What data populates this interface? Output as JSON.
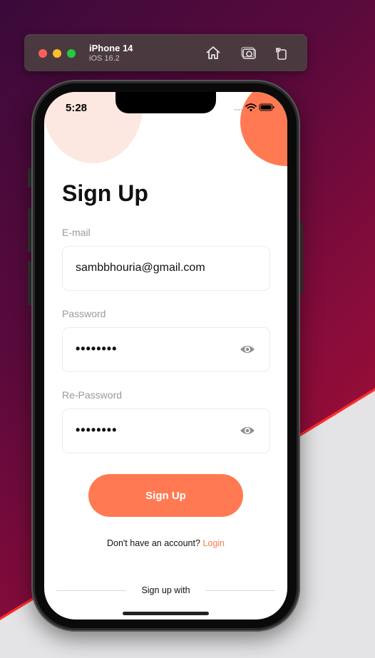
{
  "simulator": {
    "device_name": "iPhone 14",
    "os_version": "iOS 16.2",
    "toolbar_icons": [
      "home-icon",
      "screenshot-icon",
      "rotate-icon"
    ]
  },
  "status_bar": {
    "time": "5:28",
    "icons": [
      "cellular-icon",
      "wifi-icon",
      "battery-icon"
    ]
  },
  "signup": {
    "title": "Sign Up",
    "email_label": "E-mail",
    "email_value": "sambbhouria@gmail.com",
    "password_label": "Password",
    "password_value": "••••••••",
    "repassword_label": "Re-Password",
    "repassword_value": "••••••••",
    "button_label": "Sign Up",
    "account_prompt": "Don't have an account?",
    "login_link": "Login",
    "divider_text": "Sign up with"
  },
  "colors": {
    "accent": "#ff7a52",
    "accent_light": "#fde8e1",
    "label_gray": "#9a9aa0"
  }
}
